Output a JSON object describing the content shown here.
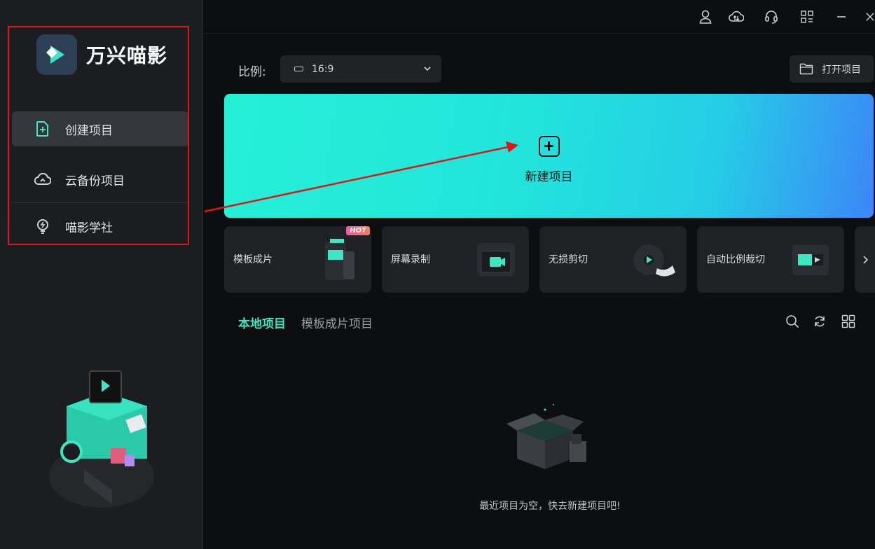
{
  "app": {
    "name": "万兴喵影",
    "accent": "#3ee6c2",
    "hero_gradient": [
      "#25f0d6",
      "#3c86f7"
    ]
  },
  "sidebar": {
    "items": [
      {
        "label": "创建项目",
        "icon": "file-plus-icon",
        "active": true
      },
      {
        "label": "云备份项目",
        "icon": "cloud-icon",
        "active": false
      },
      {
        "label": "喵影学社",
        "icon": "lightbulb-icon",
        "active": false
      }
    ]
  },
  "topbar": {
    "icons": [
      "user-icon",
      "cloud-sync-icon",
      "headset-icon",
      "grid-menu-icon",
      "minimize-icon",
      "close-icon"
    ]
  },
  "ratio": {
    "label": "比例:",
    "value": "16:9"
  },
  "open_project": {
    "label": "打开项目"
  },
  "hero": {
    "label": "新建项目"
  },
  "features": [
    {
      "label": "模板成片",
      "badge": "HOT"
    },
    {
      "label": "屏幕录制"
    },
    {
      "label": "无损剪切"
    },
    {
      "label": "自动比例裁切"
    }
  ],
  "tabs": {
    "local": "本地项目",
    "template": "模板成片项目"
  },
  "empty": {
    "message": "最近项目为空，快去新建项目吧!"
  }
}
